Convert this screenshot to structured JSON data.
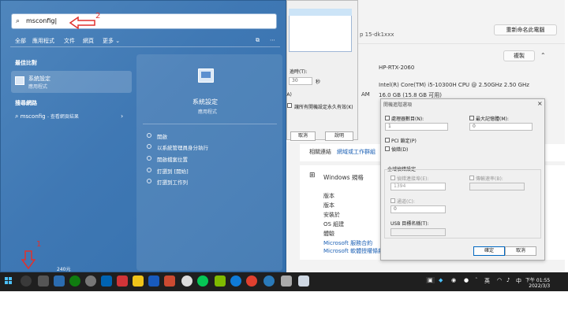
{
  "search": {
    "query": "msconfig"
  },
  "tabs": [
    "全部",
    "應用程式",
    "文件",
    "網頁",
    "更多"
  ],
  "best_match": {
    "header": "最佳比對",
    "title": "系統設定",
    "subtitle": "應用程式"
  },
  "web_search": {
    "header": "搜尋網路",
    "query": "msconfig",
    "suffix": "- 查看網頁結果"
  },
  "right_pane": {
    "title": "系統設定",
    "subtitle": "應用程式",
    "actions": [
      "開啟",
      "以系統管理員身分執行",
      "開啟檔案位置",
      "釘選到 [開始]",
      "釘選到工作列"
    ]
  },
  "annotations": {
    "arrow_search": "2",
    "arrow_taskbar": "1"
  },
  "dialog1": {
    "timeout_label": "逾時(T):",
    "timeout_value": "30",
    "seconds": "秒",
    "permanent": "讓所有開機設定永久有效(K)",
    "cancel": "取消",
    "help": "說明",
    "partial": "(A)",
    "rowtail": "p 15-dk1xxx"
  },
  "settings": {
    "rename": "重新命名此電腦",
    "copy": "複製",
    "device_name": "HP-RTX-2060",
    "cpu": "Intel(R) Core(TM) i5-10300H CPU @ 2.50GHz   2.50 GHz",
    "ram": "16.0 GB (15.8 GB 可用)",
    "ram_label": "AM",
    "tab_related": "相關連結",
    "tab_domain": "網域或工作群組",
    "winspec": "Windows 規格",
    "labels": [
      "版本",
      "版本",
      "安裝於",
      "OS 組建",
      "體驗"
    ],
    "ms_service": "Microsoft 服務合約",
    "ms_license": "Microsoft 軟體授權條款",
    "bottom_text": "240元"
  },
  "dialog2": {
    "title": "開機進階選項",
    "num_cpu": "處理器數目(N):",
    "num_cpu_val": "1",
    "max_mem": "最大記憶體(M):",
    "max_mem_val": "0",
    "pci": "PCI 鎖定(P)",
    "debug": "偵錯(D)",
    "global_debug": "全域偵錯設定",
    "debug_port": "偵錯連接埠(E):",
    "debug_port_val": "1394",
    "baud": "傳輸速率(B):",
    "channel": "通道(C):",
    "channel_val": "0",
    "usb": "USB 目標名稱(T):",
    "ok": "確定",
    "cancel": "取消"
  },
  "taskbar": {
    "time": "下午 01:55",
    "date": "2022/3/3",
    "lang": "英",
    "lang2": "中"
  }
}
